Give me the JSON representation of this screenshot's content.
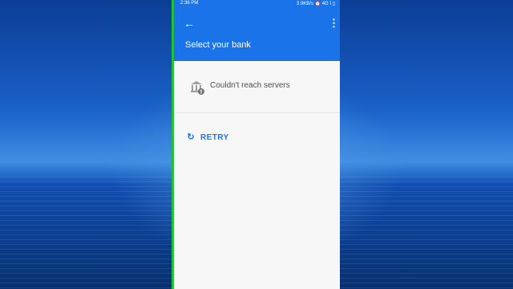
{
  "status_bar": {
    "time": "2:36 PM",
    "indicators": "3.9KB/s ⏰ 4G 𝗅 ▯"
  },
  "app_bar": {
    "title": "Select your bank",
    "back_icon": "arrow-back-icon",
    "menu_icon": "more-vert-icon"
  },
  "error": {
    "icon": "bank-icon",
    "message": "Couldn't reach servers"
  },
  "retry": {
    "icon": "refresh-icon",
    "label": "RETRY"
  },
  "colors": {
    "primary": "#1a73e8",
    "background": "#f7f7f7",
    "wallpaper": "#1a61c8",
    "border_accent": "#22c03a"
  }
}
